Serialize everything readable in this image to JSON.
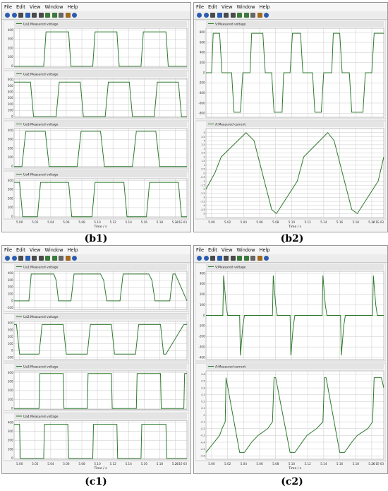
{
  "menu": [
    "File",
    "Edit",
    "View",
    "Window",
    "Help"
  ],
  "captions": {
    "b1": "(b1)",
    "b2": "(b2)",
    "c1": "(c1)",
    "c2": "(c2)"
  },
  "colors": {
    "trace": "#2f7a2f",
    "grid": "#c9c9c9",
    "header": "#e4e4e4",
    "tick": "#333333"
  },
  "toolbar_icons": [
    "back-icon",
    "forward-icon",
    "zoom-icon",
    "zoom-box-icon",
    "fit-icon",
    "cursor-icon",
    "camera-icon",
    "save-icon",
    "grid-icon",
    "copy-icon",
    "help-icon"
  ],
  "chart_data": [
    {
      "panel": "b1",
      "type": "line",
      "xlabel": "Time / s",
      "xlim": [
        4.993,
        5.215
      ],
      "xticks": [
        "5.00",
        "5.02",
        "5.04",
        "5.06",
        "5.08",
        "5.10",
        "5.12",
        "5.14",
        "5.16",
        "5.18",
        "5.20"
      ],
      "xtick_values": [
        5.0,
        5.02,
        5.04,
        5.06,
        5.08,
        5.1,
        5.12,
        5.14,
        5.16,
        5.18,
        5.2
      ],
      "x_multiplier": "× 1E-03",
      "plots": [
        {
          "title": "Ua1:Measured voltage",
          "ylim": [
            -10,
            420
          ],
          "yticks": [
            0,
            100,
            200,
            300,
            400
          ],
          "series": [
            {
              "x": [
                4.993,
                5.031,
                5.034,
                5.063,
                5.066,
                5.094,
                5.097,
                5.125,
                5.128,
                5.156,
                5.159,
                5.188,
                5.191,
                5.215
              ],
              "y": [
                0,
                0,
                380,
                380,
                0,
                0,
                380,
                380,
                0,
                0,
                380,
                380,
                0,
                0
              ]
            }
          ]
        },
        {
          "title": "Ua2:Measured voltage",
          "ylim": [
            -10,
            620
          ],
          "yticks": [
            0,
            100,
            200,
            300,
            400,
            500,
            600
          ],
          "series": [
            {
              "x": [
                4.993,
                5.014,
                5.018,
                5.047,
                5.051,
                5.078,
                5.082,
                5.11,
                5.114,
                5.141,
                5.145,
                5.173,
                5.177,
                5.204,
                5.208,
                5.215
              ],
              "y": [
                560,
                560,
                0,
                0,
                560,
                560,
                0,
                0,
                560,
                560,
                0,
                0,
                560,
                560,
                0,
                0
              ]
            }
          ]
        },
        {
          "title": "Ua3:Measured voltage",
          "ylim": [
            -10,
            420
          ],
          "yticks": [
            0,
            100,
            200,
            300,
            400
          ],
          "series": [
            {
              "x": [
                4.993,
                5.003,
                5.008,
                5.033,
                5.038,
                5.074,
                5.079,
                5.104,
                5.109,
                5.145,
                5.15,
                5.175,
                5.18,
                5.215
              ],
              "y": [
                0,
                0,
                390,
                390,
                0,
                0,
                390,
                390,
                0,
                0,
                390,
                390,
                0,
                0
              ]
            }
          ]
        },
        {
          "title": "Ua4:Measured voltage",
          "ylim": [
            -10,
            420
          ],
          "yticks": [
            0,
            100,
            200,
            300,
            400
          ],
          "series": [
            {
              "x": [
                4.993,
                5.0,
                5.004,
                5.023,
                5.027,
                5.063,
                5.067,
                5.093,
                5.097,
                5.134,
                5.138,
                5.163,
                5.167,
                5.204,
                5.208,
                5.215
              ],
              "y": [
                380,
                380,
                0,
                0,
                380,
                380,
                0,
                0,
                380,
                380,
                0,
                0,
                380,
                380,
                0,
                0
              ]
            }
          ]
        }
      ]
    },
    {
      "panel": "b2",
      "type": "line",
      "xlabel": "Time / s",
      "xlim": [
        4.993,
        5.215
      ],
      "xticks": [
        "5.00",
        "5.02",
        "5.04",
        "5.06",
        "5.08",
        "5.10",
        "5.12",
        "5.14",
        "5.16",
        "5.18",
        "5.20"
      ],
      "xtick_values": [
        5.0,
        5.02,
        5.04,
        5.06,
        5.08,
        5.1,
        5.12,
        5.14,
        5.16,
        5.18,
        5.2
      ],
      "x_multiplier": "× 1E-03",
      "plots": [
        {
          "title": "V:Measured voltage",
          "ylim": [
            -880,
            880
          ],
          "yticks": [
            -800,
            -600,
            -400,
            -200,
            0,
            200,
            400,
            600,
            800
          ],
          "series": [
            {
              "x": [
                4.993,
                5.0,
                5.002,
                5.01,
                5.013,
                5.025,
                5.028,
                5.036,
                5.039,
                5.048,
                5.05,
                5.064,
                5.067,
                5.075,
                5.078,
                5.088,
                5.09,
                5.098,
                5.101,
                5.111,
                5.114,
                5.126,
                5.129,
                5.137,
                5.14,
                5.15,
                5.152,
                5.16,
                5.163,
                5.172,
                5.175,
                5.189,
                5.192,
                5.2,
                5.203,
                5.211,
                5.215
              ],
              "y": [
                0,
                0,
                780,
                780,
                0,
                0,
                -780,
                -780,
                0,
                0,
                780,
                780,
                0,
                0,
                -780,
                -780,
                0,
                0,
                780,
                780,
                0,
                0,
                -780,
                -780,
                0,
                0,
                780,
                780,
                0,
                0,
                -780,
                -780,
                0,
                0,
                780,
                780,
                780
              ]
            }
          ]
        },
        {
          "title": "A:Measured current",
          "ylim": [
            -5.5,
            5.5
          ],
          "yticks": [
            -5,
            -4.5,
            -4,
            -3.5,
            -3,
            -2.5,
            -2,
            -1.5,
            -1,
            -0.5,
            0,
            0.5,
            1,
            1.5,
            2,
            2.5,
            3,
            3.5,
            4,
            4.5,
            5
          ],
          "series": [
            {
              "x": [
                4.993,
                5.004,
                5.012,
                5.043,
                5.053,
                5.075,
                5.081,
                5.107,
                5.115,
                5.145,
                5.153,
                5.175,
                5.182,
                5.208,
                5.215
              ],
              "y": [
                -2,
                0,
                2,
                5,
                4,
                -4.5,
                -5,
                -1,
                2,
                5,
                4,
                -4.5,
                -5,
                -1,
                2
              ]
            }
          ]
        }
      ]
    },
    {
      "panel": "c1",
      "type": "line",
      "xlabel": "Time / s",
      "xlim": [
        4.993,
        5.215
      ],
      "xticks": [
        "5.00",
        "5.02",
        "5.04",
        "5.06",
        "5.08",
        "5.10",
        "5.12",
        "5.14",
        "5.16",
        "5.18",
        "5.20"
      ],
      "xtick_values": [
        5.0,
        5.02,
        5.04,
        5.06,
        5.08,
        5.1,
        5.12,
        5.14,
        5.16,
        5.18,
        5.2
      ],
      "x_multiplier": "× 1E-03",
      "plots": [
        {
          "title": "Ua1:Measured voltage",
          "ylim": [
            -130,
            430
          ],
          "yticks": [
            -100,
            0,
            100,
            200,
            300,
            400
          ],
          "series": [
            {
              "x": [
                4.993,
                5.012,
                5.015,
                5.044,
                5.047,
                5.05,
                5.066,
                5.07,
                5.073,
                5.104,
                5.108,
                5.112,
                5.129,
                5.133,
                5.136,
                5.166,
                5.17,
                5.174,
                5.193,
                5.197,
                5.2,
                5.215
              ],
              "y": [
                0,
                0,
                390,
                390,
                300,
                0,
                0,
                390,
                390,
                390,
                300,
                0,
                0,
                390,
                390,
                390,
                300,
                0,
                0,
                390,
                390,
                0
              ]
            }
          ]
        },
        {
          "title": "Ua2:Measured voltage",
          "ylim": [
            -130,
            430
          ],
          "yticks": [
            -100,
            0,
            100,
            200,
            300,
            400
          ],
          "series": [
            {
              "x": [
                4.993,
                4.996,
                5.0,
                5.025,
                5.029,
                5.031,
                5.056,
                5.06,
                5.063,
                5.087,
                5.091,
                5.094,
                5.118,
                5.122,
                5.125,
                5.149,
                5.153,
                5.156,
                5.181,
                5.185,
                5.188,
                5.211,
                5.215
              ],
              "y": [
                380,
                380,
                -50,
                -50,
                380,
                380,
                380,
                -50,
                -50,
                -50,
                380,
                380,
                380,
                -50,
                -50,
                -50,
                380,
                380,
                380,
                -50,
                -50,
                380,
                380
              ]
            }
          ]
        },
        {
          "title": "Ua3:Measured voltage",
          "ylim": [
            -10,
            420
          ],
          "yticks": [
            0,
            100,
            200,
            300,
            400
          ],
          "series": [
            {
              "x": [
                4.993,
                5.025,
                5.026,
                5.056,
                5.057,
                5.087,
                5.088,
                5.118,
                5.119,
                5.15,
                5.151,
                5.181,
                5.182,
                5.211,
                5.212,
                5.215
              ],
              "y": [
                0,
                0,
                390,
                390,
                0,
                0,
                390,
                390,
                0,
                0,
                390,
                390,
                0,
                0,
                390,
                390
              ]
            }
          ]
        },
        {
          "title": "Ua4:Measured voltage",
          "ylim": [
            -10,
            420
          ],
          "yticks": [
            0,
            100,
            200,
            300,
            400
          ],
          "series": [
            {
              "x": [
                4.993,
                5.0,
                5.001,
                5.031,
                5.032,
                5.062,
                5.063,
                5.094,
                5.095,
                5.125,
                5.126,
                5.156,
                5.157,
                5.188,
                5.189,
                5.215
              ],
              "y": [
                380,
                380,
                0,
                0,
                380,
                380,
                0,
                0,
                380,
                380,
                0,
                0,
                380,
                380,
                0,
                0
              ]
            }
          ]
        }
      ]
    },
    {
      "panel": "c2",
      "type": "line",
      "xlabel": "Time / s",
      "xlim": [
        4.993,
        5.215
      ],
      "xticks": [
        "5.00",
        "5.02",
        "5.04",
        "5.06",
        "5.08",
        "5.10",
        "5.12",
        "5.14",
        "5.16",
        "5.18",
        "5.20"
      ],
      "xtick_values": [
        5.0,
        5.02,
        5.04,
        5.06,
        5.08,
        5.1,
        5.12,
        5.14,
        5.16,
        5.18,
        5.2
      ],
      "x_multiplier": "× 1E-03",
      "plots": [
        {
          "title": "V:Measured voltage",
          "ylim": [
            -420,
            420
          ],
          "yticks": [
            -400,
            -300,
            -200,
            -100,
            0,
            100,
            200,
            300,
            400
          ],
          "series": [
            {
              "x": [
                4.993,
                5.014,
                5.015,
                5.018,
                5.02,
                5.035,
                5.036,
                5.039,
                5.041,
                5.076,
                5.077,
                5.08,
                5.082,
                5.098,
                5.099,
                5.102,
                5.104,
                5.138,
                5.139,
                5.142,
                5.144,
                5.161,
                5.162,
                5.165,
                5.167,
                5.201,
                5.202,
                5.205,
                5.207,
                5.215
              ],
              "y": [
                0,
                0,
                380,
                100,
                0,
                0,
                -380,
                -100,
                0,
                0,
                380,
                100,
                0,
                0,
                -380,
                -100,
                0,
                0,
                380,
                100,
                0,
                0,
                -380,
                -100,
                0,
                0,
                380,
                100,
                0,
                0
              ]
            }
          ]
        },
        {
          "title": "A:Measured current",
          "ylim": [
            -0.65,
            0.65
          ],
          "yticks": [
            -0.6,
            -0.5,
            -0.4,
            -0.3,
            -0.2,
            -0.1,
            0,
            0.1,
            0.2,
            0.3,
            0.4,
            0.5,
            0.6
          ],
          "series": [
            {
              "x": [
                4.993,
                5.01,
                5.013,
                5.017,
                5.018,
                5.035,
                5.041,
                5.05,
                5.058,
                5.07,
                5.076,
                5.078,
                5.08,
                5.098,
                5.104,
                5.113,
                5.119,
                5.131,
                5.139,
                5.141,
                5.143,
                5.16,
                5.166,
                5.175,
                5.182,
                5.195,
                5.201,
                5.203,
                5.205,
                5.212,
                5.215
              ],
              "y": [
                -0.55,
                -0.3,
                -0.2,
                -0.1,
                0.55,
                -0.55,
                -0.55,
                -0.4,
                -0.3,
                -0.2,
                -0.1,
                0.55,
                0.55,
                -0.55,
                -0.55,
                -0.4,
                -0.3,
                -0.2,
                -0.1,
                0.55,
                0.55,
                -0.55,
                -0.55,
                -0.4,
                -0.3,
                -0.2,
                -0.1,
                0.55,
                0.55,
                0.55,
                0.4
              ]
            }
          ]
        }
      ]
    }
  ]
}
